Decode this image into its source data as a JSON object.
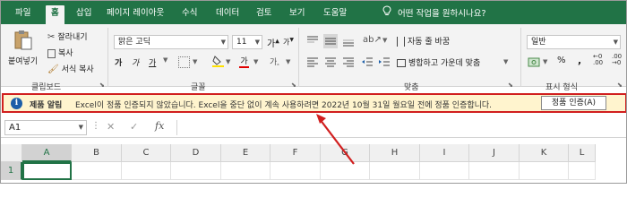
{
  "tabs": [
    {
      "label": "파일",
      "active": false
    },
    {
      "label": "홈",
      "active": true
    },
    {
      "label": "삽입",
      "active": false
    },
    {
      "label": "페이지 레이아웃",
      "active": false
    },
    {
      "label": "수식",
      "active": false
    },
    {
      "label": "데이터",
      "active": false
    },
    {
      "label": "검토",
      "active": false
    },
    {
      "label": "보기",
      "active": false
    },
    {
      "label": "도움말",
      "active": false
    }
  ],
  "tell_me": "어떤 작업을 원하시나요?",
  "ribbon": {
    "clipboard": {
      "paste": "붙여넣기",
      "cut": "잘라내기",
      "copy": "복사",
      "format_painter": "서식 복사",
      "label": "클립보드"
    },
    "font": {
      "name": "맑은 고딕",
      "size": "11",
      "bold": "가",
      "italic": "가",
      "underline": "가",
      "font_color_glyph": "가",
      "grow": "가",
      "shrink": "가",
      "label": "글꼴"
    },
    "alignment": {
      "wrap": "자동 줄 바꿈",
      "merge": "병합하고 가운데 맞춤",
      "label": "맞춤"
    },
    "number": {
      "format": "일반",
      "percent": "%",
      "comma": ",",
      "label": "표시 형식"
    }
  },
  "message_bar": {
    "title": "제품 알림",
    "text": "Excel이 정품 인증되지 않았습니다. Excel을 중단 없이 계속 사용하려면 2022년 10월 31일 월요일 전에 정품 인증합니다.",
    "button": "정품 인증(A)"
  },
  "formula_bar": {
    "name_box": "A1",
    "fx": "fx",
    "value": ""
  },
  "grid": {
    "columns": [
      "A",
      "B",
      "C",
      "D",
      "E",
      "F",
      "G",
      "H",
      "I",
      "J",
      "K",
      "L"
    ],
    "rows": [
      "1"
    ]
  },
  "colors": {
    "accent": "#217346",
    "message_bg": "#fff4ce",
    "highlight": "#d11f1f"
  }
}
